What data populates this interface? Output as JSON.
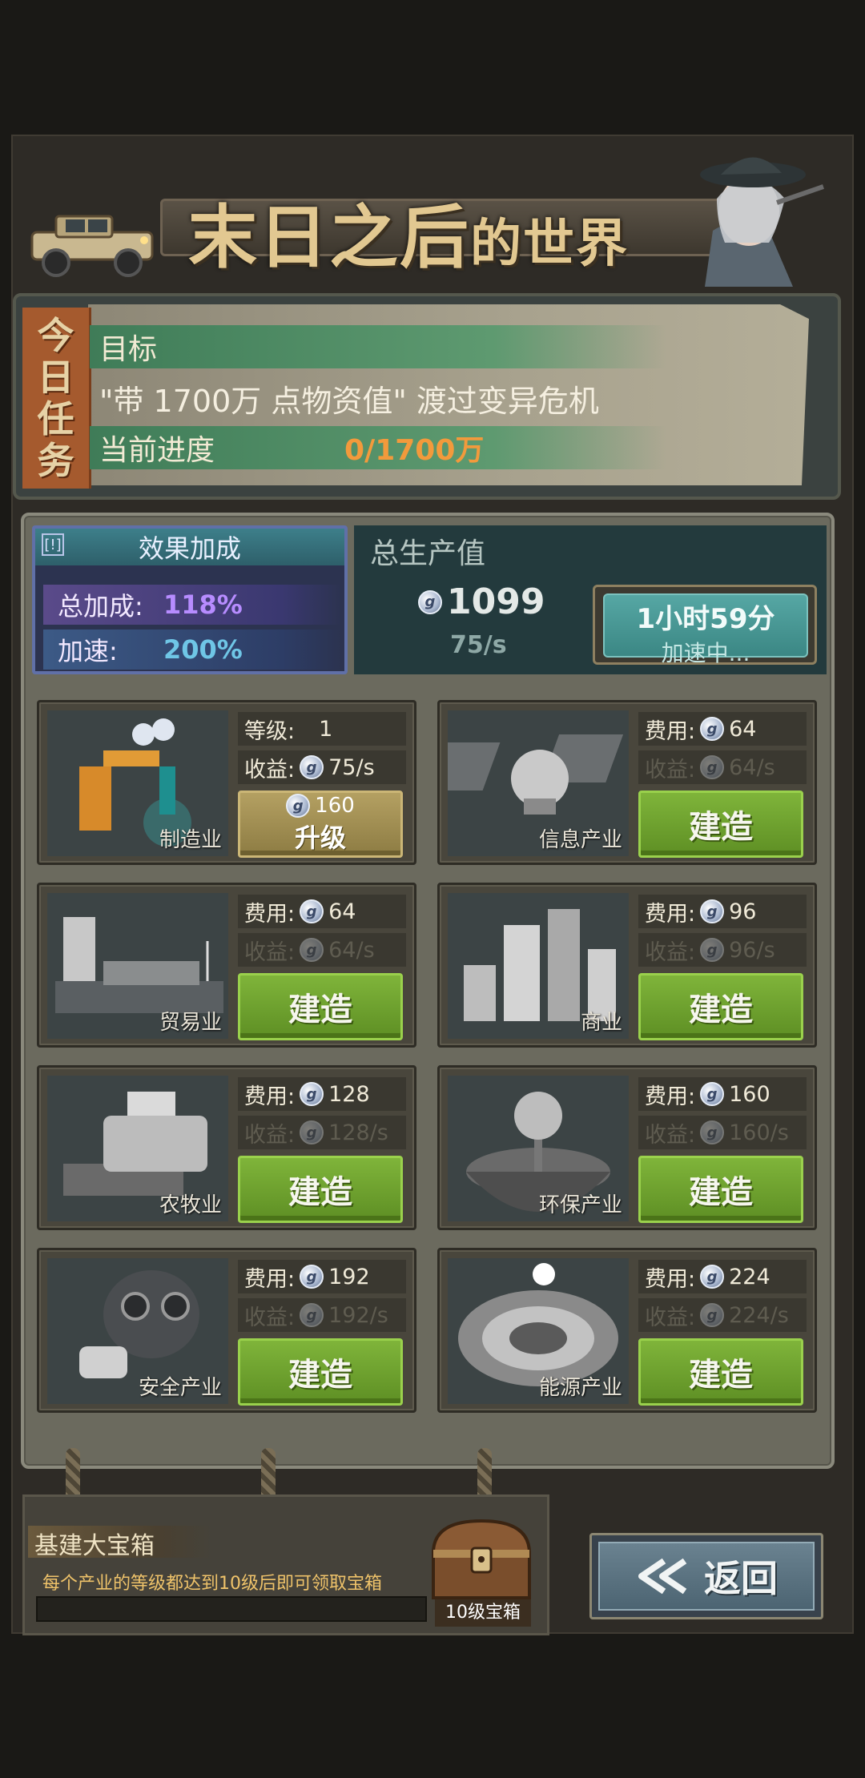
{
  "banner": {
    "title_main": "末日之后",
    "title_sub": "的世界"
  },
  "task": {
    "ribbon": [
      "今",
      "日",
      "任",
      "务"
    ],
    "goal_label": "目标",
    "goal_text": "\"带 1700万 点物资值\" 渡过变异危机",
    "progress_label": "当前进度",
    "progress_value": "0/1700万"
  },
  "bonus": {
    "title": "效果加成",
    "info_icon": "[!]",
    "total_label": "总加成:",
    "total_value": "118%",
    "speed_label": "加速:",
    "speed_value": "200%"
  },
  "production": {
    "title": "总生产值",
    "value": "1099",
    "rate": "75/s",
    "boost_time": "1小时59分",
    "boost_status": "加速中..."
  },
  "industries": [
    {
      "name": "制造业",
      "row1_label": "等级:",
      "row1_value": "1",
      "row2_label": "收益:",
      "row2_value": "75/s",
      "button": "升级",
      "button_cost": "160"
    },
    {
      "name": "信息产业",
      "row1_label": "费用:",
      "row1_value": "64",
      "row2_label": "收益:",
      "row2_value": "64/s",
      "button": "建造"
    },
    {
      "name": "贸易业",
      "row1_label": "费用:",
      "row1_value": "64",
      "row2_label": "收益:",
      "row2_value": "64/s",
      "button": "建造"
    },
    {
      "name": "商业",
      "row1_label": "费用:",
      "row1_value": "96",
      "row2_label": "收益:",
      "row2_value": "96/s",
      "button": "建造"
    },
    {
      "name": "农牧业",
      "row1_label": "费用:",
      "row1_value": "128",
      "row2_label": "收益:",
      "row2_value": "128/s",
      "button": "建造"
    },
    {
      "name": "环保产业",
      "row1_label": "费用:",
      "row1_value": "160",
      "row2_label": "收益:",
      "row2_value": "160/s",
      "button": "建造"
    },
    {
      "name": "安全产业",
      "row1_label": "费用:",
      "row1_value": "192",
      "row2_label": "收益:",
      "row2_value": "192/s",
      "button": "建造"
    },
    {
      "name": "能源产业",
      "row1_label": "费用:",
      "row1_value": "224",
      "row2_label": "收益:",
      "row2_value": "224/s",
      "button": "建造"
    }
  ],
  "coin_glyph": "g",
  "chest": {
    "title": "基建大宝箱",
    "desc": "每个产业的等级都达到10级后即可领取宝箱",
    "label": "10级宝箱"
  },
  "back": {
    "label": "返回"
  },
  "colors": {
    "build_green": "#7fb43a",
    "progress_orange": "#f29a3c",
    "bonus_purple": "#b78cff",
    "bonus_cyan": "#6fc6e6"
  }
}
